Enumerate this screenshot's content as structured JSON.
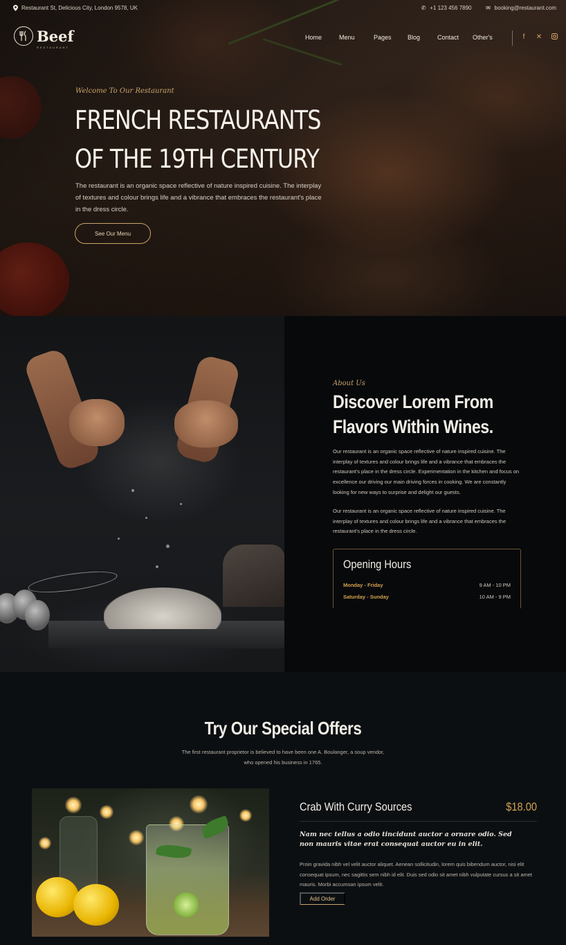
{
  "topbar": {
    "address": "Restaurant St, Delicious City, London 9578, UK",
    "phone": "+1 123 456 7890",
    "email": "booking@restaurant.com"
  },
  "brand": {
    "name": "Beef",
    "tagline": "RESTAURANT"
  },
  "nav": {
    "items": [
      "Home",
      "Menu",
      "Pages",
      "Blog",
      "Contact",
      "Other's"
    ]
  },
  "socials": [
    "facebook-icon",
    "x-icon",
    "instagram-icon"
  ],
  "hero": {
    "eyebrow": "Welcome To Our Restaurant",
    "title_line1": "FRENCH RESTAURANTS",
    "title_line2": "OF THE 19TH CENTURY",
    "description": "The restaurant is an organic space reflective of nature inspired cuisine. The interplay of textures and colour brings life and a vibrance that embraces the restaurant's place in the dress circle.",
    "cta": "See Our Menu"
  },
  "about": {
    "eyebrow": "About Us",
    "title_line1": "Discover Lorem From",
    "title_line2": "Flavors Within Wines.",
    "paragraph1": "Our restaurant is an organic space reflective of nature inspired cuisine. The interplay of textures and colour brings life and a vibrance that embraces the restaurant's place in the dress circle. Experimentation in the kitchen and focus on excellence our driving our main driving forces in cooking. We are constantly looking for new ways to surprise and delight our guests.",
    "paragraph2": "Our restaurant is an organic space reflective of nature inspired cuisine. The interplay of textures and colour brings life and a vibrance that embraces the restaurant's place in the dress circle.",
    "hours": {
      "title": "Opening Hours",
      "rows": [
        {
          "day": "Monday - Friday",
          "time": "9 AM - 10 PM"
        },
        {
          "day": "Saturday - Sunday",
          "time": "10 AM - 9 PM"
        }
      ]
    }
  },
  "offers": {
    "title": "Try Our Special Offers",
    "subtitle": "The first restaurant proprietor is believed to have been one A. Boulanger, a soup vendor, who opened his business in 1765.",
    "item": {
      "name": "Crab With Curry Sources",
      "price": "$18.00",
      "quote": "Nam nec tellus a odio tincidunt auctor a ornare odio. Sed non mauris vitae erat consequat auctor eu in elit.",
      "description": "Proin gravida nibh vel velit auctor aliquet. Aenean sollicitudin, lorem quis bibendum auctor, nisi elit consequat ipsum, nec sagittis sem nibh id elit. Duis sed odio sit amet nibh vulputate cursus a sit amet mauris. Morbi accumsan ipsum velit.",
      "cta": "Add Order"
    }
  },
  "colors": {
    "accent": "#c9a46a",
    "gold_text": "#d3a24f",
    "background": "#0c0f12"
  }
}
